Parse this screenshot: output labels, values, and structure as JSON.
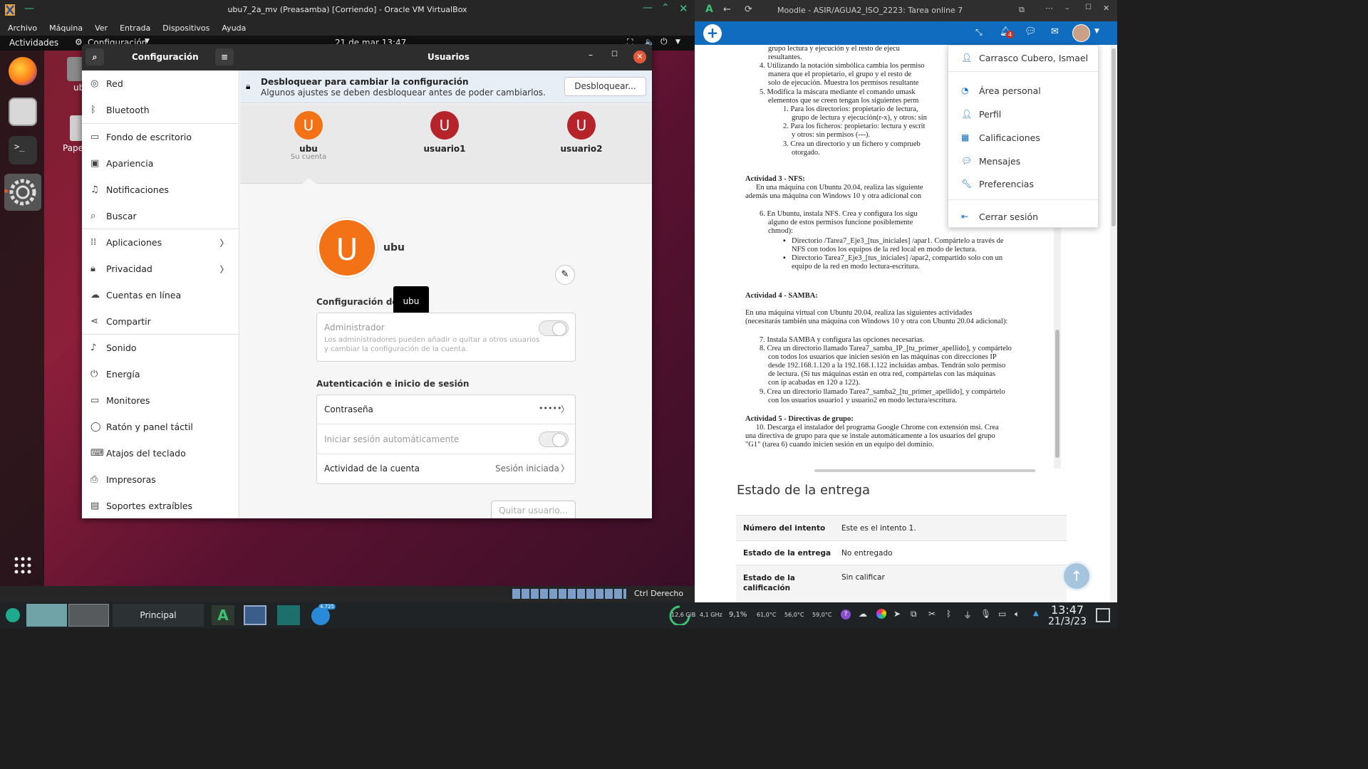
{
  "vbox": {
    "title": "ubu7_2a_mv (Preasamba) [Corriendo] - Oracle VM VirtualBox",
    "menu": [
      "Archivo",
      "Máquina",
      "Ver",
      "Entrada",
      "Dispositivos",
      "Ayuda"
    ],
    "host_key": "Ctrl Derecho"
  },
  "gnome": {
    "activities": "Actividades",
    "app_menu": "Configuración",
    "clock": "21 de mar  13:47",
    "desktop_icons": [
      "ubu",
      "Pape"
    ]
  },
  "settings": {
    "sidebar_title": "Configuración",
    "page_title": "Usuarios",
    "sidebar": [
      "Red",
      "Bluetooth",
      "Fondo de escritorio",
      "Apariencia",
      "Notificaciones",
      "Buscar",
      "Aplicaciones",
      "Privacidad",
      "Cuentas en línea",
      "Compartir",
      "Sonido",
      "Energía",
      "Monitores",
      "Ratón y panel táctil",
      "Atajos del teclado",
      "Impresoras",
      "Soportes extraíbles"
    ],
    "unlock_title": "Desbloquear para cambiar la configuración",
    "unlock_sub": "Algunos ajustes se deben desbloquear antes de poder cambiarlos.",
    "unlock_button": "Desbloquear...",
    "users": [
      {
        "initial": "U",
        "name": "ubu",
        "sub": "Su cuenta",
        "color": "#f47216"
      },
      {
        "initial": "U",
        "name": "usuario1",
        "sub": "",
        "color": "#b5232b"
      },
      {
        "initial": "U",
        "name": "usuario2",
        "sub": "",
        "color": "#b5232b"
      }
    ],
    "current_user": "ubu",
    "tooltip": "ubu",
    "config_section": "Configuración de la",
    "admin_label": "Administrador",
    "admin_desc1": "Los administradores pueden añadir o quitar a otros usuarios",
    "admin_desc2": "y cambiar la configuración de la cuenta.",
    "auth_section": "Autenticación e inicio de sesión",
    "password_label": "Contraseña",
    "password_value": "•••••",
    "autologin_label": "Iniciar sesión automáticamente",
    "activity_label": "Actividad de la cuenta",
    "activity_value": "Sesión iniciada",
    "remove_button": "Quitar usuario..."
  },
  "taskbar": {
    "main": "Principal",
    "badge": "4.725",
    "ram": "12,6 GiB",
    "cpu_freq": "4,1 GHz",
    "cpu_pct": "9,1%",
    "temps": [
      "61,0°C",
      "56,0°C",
      "59,0°C"
    ],
    "time": "13:47",
    "date": "21/3/23"
  },
  "browser": {
    "title": "Moodle - ASIR/AGUA2_ISO_2223: Tarea online 7",
    "notif_count": "4",
    "dropdown": [
      "Carrasco Cubero, Ismael",
      "Área personal",
      "Perfil",
      "Calificaciones",
      "Mensajes",
      "Preferencias",
      "Cerrar sesión"
    ],
    "doc": {
      "l1": "grupo lectura y ejecución y el resto de ejecu",
      "l2": "resultantes.",
      "l3": "4. Utilizando la notación simbólica cambia los permiso",
      "l4": "manera que el propietario, el grupo y el resto de",
      "l5": "solo de ejecución. Muestra los permisos resultante",
      "l6": "5. Modifica la máscara mediante el comando umask",
      "l7": "elementos que se creen tengan los siguientes perm",
      "l8": "1. Para los directorios: propietario de lectura,",
      "l9": "grupo de lectura y ejecución(r-x), y otros: sin",
      "l10": "2. Para los ficheros: propietario: lectura y escrit",
      "l11": "y otros: sin permisos (---).",
      "l12": "3. Crea un directorio y un fichero y comprueb",
      "l13": "otorgado.",
      "a3": "Actividad 3 - NFS:",
      "a3l1": "En una máquina con Ubuntu 20.04, realiza las siguiente",
      "a3l2": "además una máquina con Windows 10 y otra adicional con",
      "a3l3": "6. En Ubuntu, instala NFS. Crea y configura los sigu",
      "a3l4": "alguno de estos permisos funcione posiblemente",
      "a3l5": "chmod):",
      "a3l6": "Directorio /Tarea7_Eje3_[tus_iniciales] /apar1. Compártelo a través de",
      "a3l7": "NFS con todos los equipos de la red local en modo de lectura.",
      "a3l8": "Directorio Tarea7_Eje3_[tus_iniciales] /apar2, compartido solo con un",
      "a3l9": "equipo de la red en modo lectura-escritura.",
      "a4": "Actividad 4 - SAMBA:",
      "a4l1": "En una máquina virtual con Ubuntu 20.04, realiza las siguientes actividades",
      "a4l2": "(necesitarás también una máquina con Windows 10 y otra con Ubuntu 20.04 adicional):",
      "a4l3": "7. Instala SAMBA y configura las opciones necesarias.",
      "a4l4": "8. Crea un directorio llamado Tarea7_samba_IP_[tu_primer_apellido], y compártelo",
      "a4l5": "con todos los usuarios que inicien sesión en las máquinas con direcciones IP",
      "a4l6": "desde 192.168.1.120 a la 192.168.1.122 incluidas ambas. Tendrán solo permiso",
      "a4l7": "de lectura. (Si tus máquinas están en otra red, compártelas con las máquinas",
      "a4l8": "con ip acabadas en 120 a 122).",
      "a4l9": "9. Crea un directorio llamado Tarea7_samba2_[tu_primer_apellido], y compártelo",
      "a4l10": "con los usuarios usuario1 y usuario2 en modo lectura/escritura.",
      "a5": "Actividad 5 - Directivas de grupo:",
      "a5l1": "10. Descarga el instalador del programa Google Chrome con extensión msi. Crea",
      "a5l2": "una directiva de grupo para que se instale automáticamente a los usuarios del grupo",
      "a5l3": "\"G1\" (tarea 6)  cuando inicien sesión en un equipo del dominio."
    },
    "status_heading": "Estado de la entrega",
    "status_rows": [
      {
        "k": "Número del intento",
        "v": "Este es el intento 1."
      },
      {
        "k": "Estado de la entrega",
        "v": "No entregado"
      },
      {
        "k": "Estado de la calificación",
        "v": "Sin calificar"
      }
    ]
  }
}
